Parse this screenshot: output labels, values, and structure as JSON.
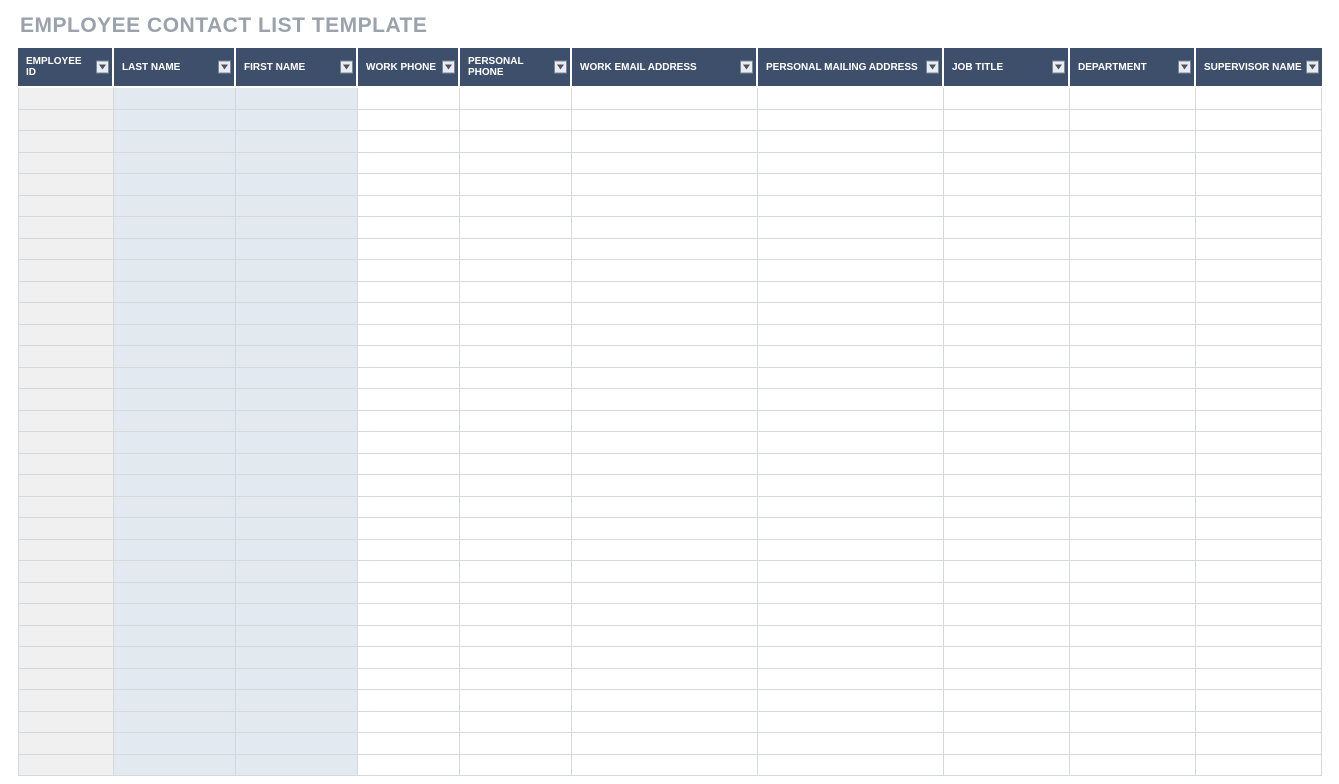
{
  "title": "EMPLOYEE CONTACT LIST TEMPLATE",
  "columns": [
    {
      "label": "EMPLOYEE ID",
      "shade": "grey"
    },
    {
      "label": "LAST NAME",
      "shade": "blue"
    },
    {
      "label": "FIRST NAME",
      "shade": "blue"
    },
    {
      "label": "WORK PHONE",
      "shade": "plain"
    },
    {
      "label": "PERSONAL PHONE",
      "shade": "plain"
    },
    {
      "label": "WORK EMAIL ADDRESS",
      "shade": "plain"
    },
    {
      "label": "PERSONAL MAILING ADDRESS",
      "shade": "plain"
    },
    {
      "label": "JOB TITLE",
      "shade": "plain"
    },
    {
      "label": "DEPARTMENT",
      "shade": "plain"
    },
    {
      "label": "SUPERVISOR NAME",
      "shade": "plain"
    }
  ],
  "row_count": 32,
  "colors": {
    "header": "#3e4f6b",
    "shade_grey": "#f0f0f0",
    "shade_blue": "#e3e9f0"
  }
}
